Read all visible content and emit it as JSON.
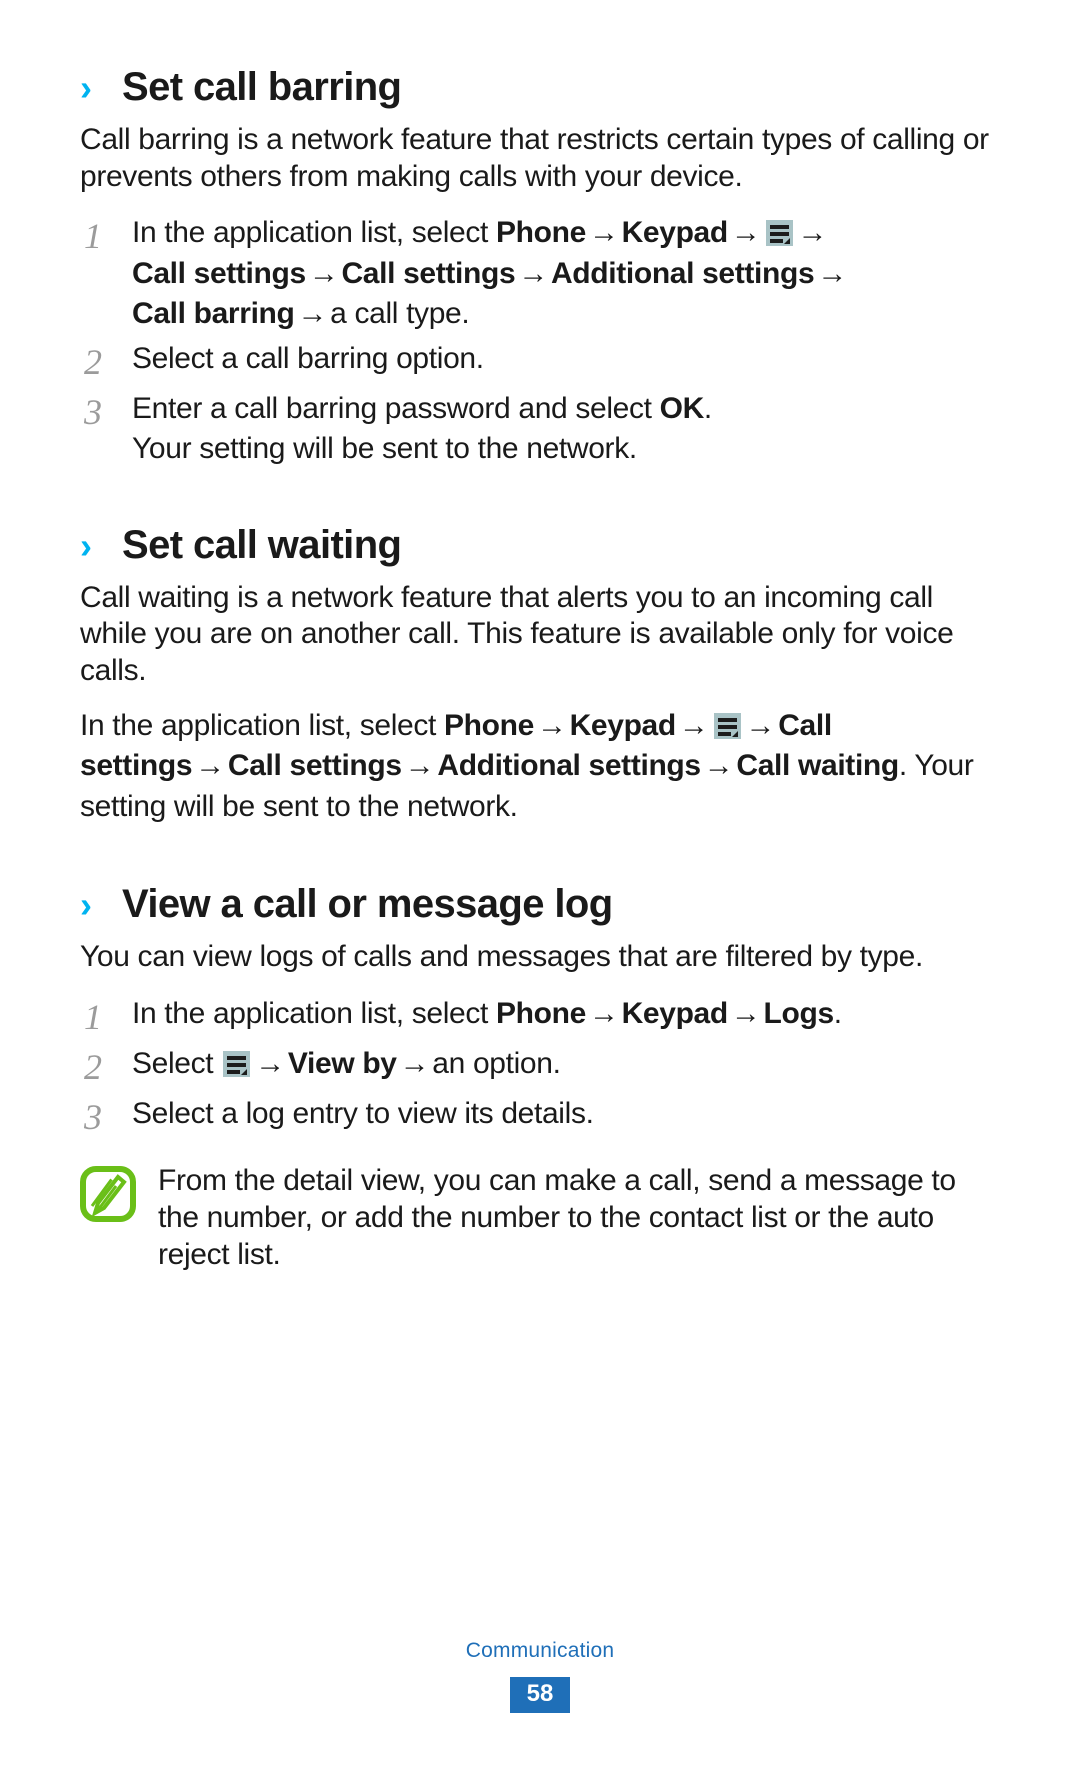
{
  "page": {
    "number": "58",
    "footer_title": "Communication",
    "accent_chevron_color": "#00b3f0",
    "footer_color": "#1f6fb8",
    "note_icon_color": "#6abf18",
    "menu_icon_bg": "#a9c3c6",
    "step_number_color": "#9b9b9b"
  },
  "sections": [
    {
      "id": "set-call-barring",
      "chevron": "›",
      "heading": "Set call barring",
      "intro": "Call barring is a network feature that restricts certain types of calling or prevents others from making calls with your device.",
      "steps": [
        {
          "num": "1",
          "pre": "In the application list, select ",
          "bold1": "Phone",
          "arrow": "→",
          "bold2": "Keypad",
          "icon": "menu-icon",
          "bold3": "Call settings",
          "bold4": "Call settings",
          "bold5": "Additional settings",
          "bold6": "Call barring",
          "tail": "a call type."
        },
        {
          "num": "2",
          "text": "Select a call barring option."
        },
        {
          "num": "3",
          "pre": "Enter a call barring password and select ",
          "bold": "OK",
          "post": ".",
          "sub": "Your setting will be sent to the network."
        }
      ]
    },
    {
      "id": "set-call-waiting",
      "chevron": "›",
      "heading": "Set call waiting",
      "intro": "Call waiting is a network feature that alerts you to an incoming call while you are on another call. This feature is available only for voice calls.",
      "instruction": {
        "pre": "In the application list, select ",
        "bold1": "Phone",
        "arrow": "→",
        "bold2": "Keypad",
        "icon": "menu-icon",
        "bold3": "Call settings",
        "bold4": "Call settings",
        "bold5": "Additional settings",
        "bold6": "Call waiting",
        "tail": ". Your setting will be sent to the network."
      }
    },
    {
      "id": "view-a-call-or-message-log",
      "chevron": "›",
      "heading": "View a call or message log",
      "intro": "You can view logs of calls and messages that are filtered by type.",
      "steps": [
        {
          "num": "1",
          "pre": "In the application list, select ",
          "bold1": "Phone",
          "arrow": "→",
          "bold2": "Keypad",
          "bold3": "Logs",
          "post": "."
        },
        {
          "num": "2",
          "pre": "Select ",
          "icon": "menu-icon",
          "arrow": "→",
          "bold1": "View by",
          "tail": "an option."
        },
        {
          "num": "3",
          "text": "Select a log entry to view its details."
        }
      ],
      "note": {
        "icon": "note-icon",
        "text": "From the detail view, you can make a call, send a message to the number, or add the number to the contact list or the auto reject list."
      }
    }
  ]
}
